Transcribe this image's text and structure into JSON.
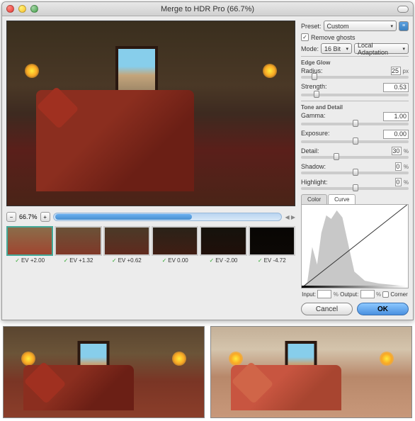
{
  "window": {
    "title": "Merge to HDR Pro (66.7%)"
  },
  "zoom": {
    "minus": "−",
    "plus": "+",
    "value": "66.7%"
  },
  "thumbnails": [
    {
      "label": "EV +2.00",
      "brightness": 1.0,
      "bg": "linear-gradient(#8a6d4a,#a04530)"
    },
    {
      "label": "EV +1.32",
      "brightness": 0.85,
      "bg": "linear-gradient(#6a5238,#803828)"
    },
    {
      "label": "EV +0.62",
      "brightness": 0.65,
      "bg": "linear-gradient(#4a3a28,#602a1e)"
    },
    {
      "label": "EV 0.00",
      "brightness": 0.45,
      "bg": "linear-gradient(#2a2218,#401e14)"
    },
    {
      "label": "EV -2.00",
      "brightness": 0.25,
      "bg": "linear-gradient(#15120c,#20100a)"
    },
    {
      "label": "EV -4.72",
      "brightness": 0.1,
      "bg": "linear-gradient(#080604,#0c0805)"
    }
  ],
  "panel": {
    "preset_label": "Preset:",
    "preset_value": "Custom",
    "remove_ghosts": "Remove ghosts",
    "remove_ghosts_checked": true,
    "mode_label": "Mode:",
    "mode_value": "16 Bit",
    "method_value": "Local Adaptation",
    "edge_glow": {
      "title": "Edge Glow",
      "radius_label": "Radius:",
      "radius_value": "25",
      "radius_unit": "px",
      "strength_label": "Strength:",
      "strength_value": "0.53"
    },
    "tone_detail": {
      "title": "Tone and Detail",
      "gamma_label": "Gamma:",
      "gamma_value": "1.00",
      "exposure_label": "Exposure:",
      "exposure_value": "0.00",
      "detail_label": "Detail:",
      "detail_value": "30",
      "detail_unit": "%",
      "shadow_label": "Shadow:",
      "shadow_value": "0",
      "shadow_unit": "%",
      "highlight_label": "Highlight:",
      "highlight_value": "0",
      "highlight_unit": "%"
    },
    "tabs": {
      "color": "Color",
      "curve": "Curve"
    },
    "curve": {
      "input_label": "Input:",
      "input_value": "",
      "output_label": "Output:",
      "output_value": "",
      "output_unit": "%",
      "corner_label": "Corner"
    },
    "buttons": {
      "cancel": "Cancel",
      "ok": "OK"
    }
  }
}
